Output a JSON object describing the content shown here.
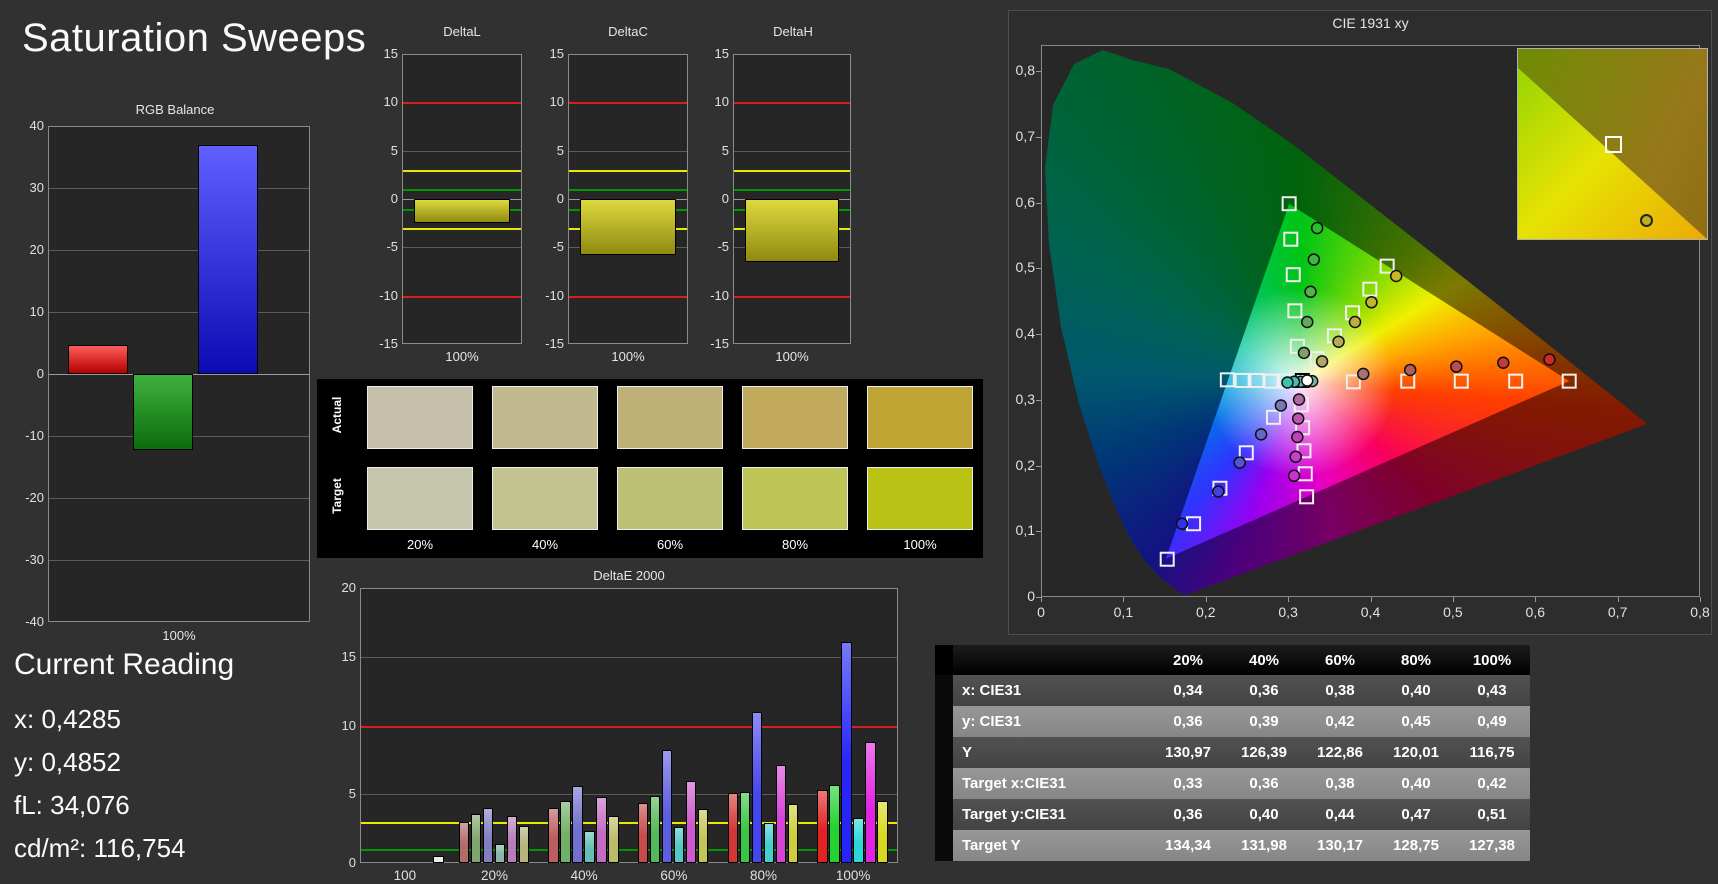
{
  "page_title": "Saturation Sweeps",
  "current_reading": {
    "title": "Current Reading",
    "lines": [
      "x: 0,4285",
      "y: 0,4852",
      "fL: 34,076",
      "cd/m²: 116,754"
    ]
  },
  "colors": {
    "background": "#313131",
    "plot_background": "#262626",
    "limit_red": "#d42020",
    "limit_yellow": "#e8e800",
    "limit_green": "#009600",
    "gridline": "#5c5c5c",
    "zero_axis": "#9a9a9a",
    "frame": "#8a8a8a",
    "white_bar": "#ececec"
  },
  "swatches": {
    "row_labels": [
      "Actual",
      "Target"
    ],
    "col_labels": [
      "20%",
      "40%",
      "60%",
      "80%",
      "100%"
    ],
    "actual_colors": [
      "#c6c0aa",
      "#c2b98f",
      "#bfb077",
      "#c1aa5c",
      "#bfa434"
    ],
    "target_colors": [
      "#c5c6ab",
      "#c3c390",
      "#bdc174",
      "#bec455",
      "#b9c114"
    ]
  },
  "table": {
    "header": [
      "20%",
      "40%",
      "60%",
      "80%",
      "100%"
    ],
    "rows": [
      {
        "label": "x: CIE31",
        "values": [
          "0,34",
          "0,36",
          "0,38",
          "0,40",
          "0,43"
        ],
        "stripe": "dark"
      },
      {
        "label": "y: CIE31",
        "values": [
          "0,36",
          "0,39",
          "0,42",
          "0,45",
          "0,49"
        ],
        "stripe": "light"
      },
      {
        "label": "Y",
        "values": [
          "130,97",
          "126,39",
          "122,86",
          "120,01",
          "116,75"
        ],
        "stripe": "dark"
      },
      {
        "label": "Target x:CIE31",
        "values": [
          "0,33",
          "0,36",
          "0,38",
          "0,40",
          "0,42"
        ],
        "stripe": "light"
      },
      {
        "label": "Target y:CIE31",
        "values": [
          "0,36",
          "0,40",
          "0,44",
          "0,47",
          "0,51"
        ],
        "stripe": "dark"
      },
      {
        "label": "Target Y",
        "values": [
          "134,34",
          "131,98",
          "130,17",
          "128,75",
          "127,38"
        ],
        "stripe": "light"
      }
    ]
  },
  "chart_data": [
    {
      "id": "rgb_balance",
      "type": "bar",
      "title": "RGB Balance",
      "xlabel": "100%",
      "categories": [
        "Red",
        "Green",
        "Blue"
      ],
      "values": [
        4.6,
        -12.3,
        37.0
      ],
      "ylim": [
        -40,
        40
      ],
      "yticks": [
        40,
        30,
        20,
        10,
        0,
        -10,
        -20,
        -30,
        -40
      ],
      "bar_colors": [
        [
          "#ff5c5c",
          "#b40000"
        ],
        [
          "#3fb03f",
          "#0c6c0c"
        ],
        [
          "#6060ff",
          "#0b0bb4"
        ]
      ]
    },
    {
      "id": "delta_l",
      "type": "bar",
      "title": "DeltaL",
      "xlabel": "100%",
      "categories": [
        "100%"
      ],
      "values": [
        -2.5
      ],
      "ylim": [
        -15,
        15
      ],
      "yticks": [
        15,
        10,
        5,
        0,
        -5,
        -10,
        -15
      ],
      "limits": {
        "red": 10,
        "yellow": 3,
        "green": 1
      },
      "bar_colors": [
        [
          "#ded93f",
          "#8f8a10"
        ]
      ]
    },
    {
      "id": "delta_c",
      "type": "bar",
      "title": "DeltaC",
      "xlabel": "100%",
      "categories": [
        "100%"
      ],
      "values": [
        -5.8
      ],
      "ylim": [
        -15,
        15
      ],
      "yticks": [
        15,
        10,
        5,
        0,
        -5,
        -10,
        -15
      ],
      "limits": {
        "red": 10,
        "yellow": 3,
        "green": 1
      },
      "bar_colors": [
        [
          "#ded93f",
          "#8f8a10"
        ]
      ]
    },
    {
      "id": "delta_h",
      "type": "bar",
      "title": "DeltaH",
      "xlabel": "100%",
      "categories": [
        "100%"
      ],
      "values": [
        -6.5
      ],
      "ylim": [
        -15,
        15
      ],
      "yticks": [
        15,
        10,
        5,
        0,
        -5,
        -10,
        -15
      ],
      "limits": {
        "red": 10,
        "yellow": 3,
        "green": 1
      },
      "bar_colors": [
        [
          "#ded93f",
          "#8f8a10"
        ]
      ]
    },
    {
      "id": "deltae_2000",
      "type": "bar",
      "title": "DeltaE 2000",
      "ylim": [
        0,
        20
      ],
      "yticks": [
        0,
        5,
        10,
        15,
        20
      ],
      "limits": {
        "red": 10,
        "yellow": 3,
        "green": 1
      },
      "categories": [
        "100",
        "20%",
        "40%",
        "60%",
        "80%",
        "100%"
      ],
      "series_names": [
        "white",
        "red",
        "green",
        "blue",
        "cyan",
        "magenta",
        "yellow"
      ],
      "groups": [
        {
          "label": "100",
          "values": [
            0.5
          ],
          "colors": [
            "#ececec"
          ]
        },
        {
          "label": "20%",
          "values": [
            3.0,
            3.6,
            4.0,
            1.4,
            3.4,
            2.7
          ],
          "colors": [
            "#b26a6a",
            "#7fa66e",
            "#8080c0",
            "#88b5a8",
            "#b77cb7",
            "#b3b37b"
          ]
        },
        {
          "label": "40%",
          "values": [
            4.0,
            4.5,
            5.6,
            2.3,
            4.8,
            3.4
          ],
          "colors": [
            "#bd5d5d",
            "#72b065",
            "#7272ce",
            "#66bfb3",
            "#c46cc4",
            "#bbbb6a"
          ]
        },
        {
          "label": "60%",
          "values": [
            4.4,
            4.9,
            8.2,
            2.6,
            6.0,
            3.9
          ],
          "colors": [
            "#c84b4b",
            "#52ba56",
            "#5e5ee0",
            "#54c7c7",
            "#ce58ce",
            "#c5c555"
          ]
        },
        {
          "label": "80%",
          "values": [
            5.1,
            5.2,
            11.0,
            2.9,
            7.1,
            4.3
          ],
          "colors": [
            "#d43636",
            "#3ac642",
            "#4646ee",
            "#43cfcf",
            "#d842d8",
            "#cece3c"
          ]
        },
        {
          "label": "100%",
          "values": [
            5.3,
            5.7,
            16.1,
            3.3,
            8.8,
            4.5
          ],
          "colors": [
            "#e22323",
            "#24d230",
            "#2626f8",
            "#2ad8d8",
            "#e224e2",
            "#d8d821"
          ]
        }
      ]
    },
    {
      "id": "cie_1931",
      "type": "scatter",
      "title": "CIE 1931 xy",
      "xlim": [
        0,
        0.8
      ],
      "ylim": [
        0,
        0.84
      ],
      "x_tick_labels": [
        "0",
        "0,1",
        "0,2",
        "0,3",
        "0,4",
        "0,5",
        "0,6",
        "0,7",
        "0,8"
      ],
      "y_tick_labels": [
        "0",
        "0,1",
        "0,2",
        "0,3",
        "0,4",
        "0,5",
        "0,6",
        "0,7",
        "0,8"
      ],
      "gamut_triangle": [
        [
          0.64,
          0.33
        ],
        [
          0.3,
          0.6
        ],
        [
          0.15,
          0.06
        ]
      ],
      "white_point": {
        "target": [
          0.316,
          0.331
        ],
        "measured": [
          0.322,
          0.331
        ],
        "measured_color": "#ffffff"
      },
      "sweeps": [
        {
          "name": "red",
          "targets": [
            [
              0.378,
              0.329
            ],
            [
              0.444,
              0.33
            ],
            [
              0.509,
              0.33
            ],
            [
              0.575,
              0.33
            ],
            [
              0.64,
              0.33
            ]
          ],
          "measured": [
            [
              0.39,
              0.341
            ],
            [
              0.447,
              0.347
            ],
            [
              0.503,
              0.352
            ],
            [
              0.56,
              0.358
            ],
            [
              0.616,
              0.363
            ]
          ],
          "measured_colors": [
            "#a87070",
            "#b25e5e",
            "#bc4c4c",
            "#c63a3a",
            "#d02828"
          ]
        },
        {
          "name": "green",
          "targets": [
            [
              0.31,
              0.383
            ],
            [
              0.307,
              0.437
            ],
            [
              0.305,
              0.492
            ],
            [
              0.302,
              0.546
            ],
            [
              0.3,
              0.6
            ]
          ],
          "measured": [
            [
              0.318,
              0.373
            ],
            [
              0.322,
              0.42
            ],
            [
              0.326,
              0.466
            ],
            [
              0.33,
              0.515
            ],
            [
              0.334,
              0.563
            ]
          ],
          "measured_colors": [
            "#7da06b",
            "#68a85c",
            "#53b04d",
            "#3eb83e",
            "#29c02f"
          ]
        },
        {
          "name": "blue",
          "targets": [
            [
              0.281,
              0.275
            ],
            [
              0.248,
              0.221
            ],
            [
              0.216,
              0.167
            ],
            [
              0.184,
              0.113
            ],
            [
              0.152,
              0.059
            ]
          ],
          "measured": [
            [
              0.29,
              0.293
            ],
            [
              0.266,
              0.249
            ],
            [
              0.24,
              0.206
            ],
            [
              0.214,
              0.162
            ],
            [
              0.17,
              0.113
            ]
          ],
          "measured_colors": [
            "#7878b8",
            "#6666c6",
            "#5454d4",
            "#4242e2",
            "#3030f0"
          ]
        },
        {
          "name": "cyan",
          "targets": [
            [
              0.296,
              0.33
            ],
            [
              0.278,
              0.33
            ],
            [
              0.261,
              0.331
            ],
            [
              0.243,
              0.331
            ],
            [
              0.225,
              0.332
            ]
          ],
          "measured": [
            [
              0.328,
              0.33
            ],
            [
              0.321,
              0.33
            ],
            [
              0.314,
              0.329
            ],
            [
              0.306,
              0.329
            ],
            [
              0.298,
              0.328
            ]
          ],
          "measured_colors": [
            "#7ab3a9",
            "#6bb6ab",
            "#5cb9ad",
            "#4dbcaf",
            "#3ec0b2"
          ]
        },
        {
          "name": "magenta",
          "targets": [
            [
              0.3148,
              0.294
            ],
            [
              0.3164,
              0.259
            ],
            [
              0.318,
              0.224
            ],
            [
              0.3196,
              0.189
            ],
            [
              0.3212,
              0.154
            ]
          ],
          "measured": [
            [
              0.312,
              0.302
            ],
            [
              0.311,
              0.273
            ],
            [
              0.31,
              0.245
            ],
            [
              0.308,
              0.215
            ],
            [
              0.306,
              0.186
            ]
          ],
          "measured_colors": [
            "#b068a0",
            "#b855b0",
            "#c042c0",
            "#c83fd0",
            "#d02cd8"
          ]
        },
        {
          "name": "yellow",
          "targets": [
            [
              0.334,
              0.364
            ],
            [
              0.355,
              0.399
            ],
            [
              0.377,
              0.434
            ],
            [
              0.398,
              0.47
            ],
            [
              0.419,
              0.505
            ]
          ],
          "measured": [
            [
              0.34,
              0.36
            ],
            [
              0.36,
              0.39
            ],
            [
              0.38,
              0.42
            ],
            [
              0.4,
              0.45
            ],
            [
              0.43,
              0.49
            ]
          ],
          "measured_colors": [
            "#b0a860",
            "#b6ac50",
            "#bcb040",
            "#c2b430",
            "#c8b820"
          ]
        }
      ],
      "inset": {
        "square": [
          0.5,
          0.5
        ],
        "circle": [
          0.675,
          0.9
        ]
      }
    }
  ]
}
